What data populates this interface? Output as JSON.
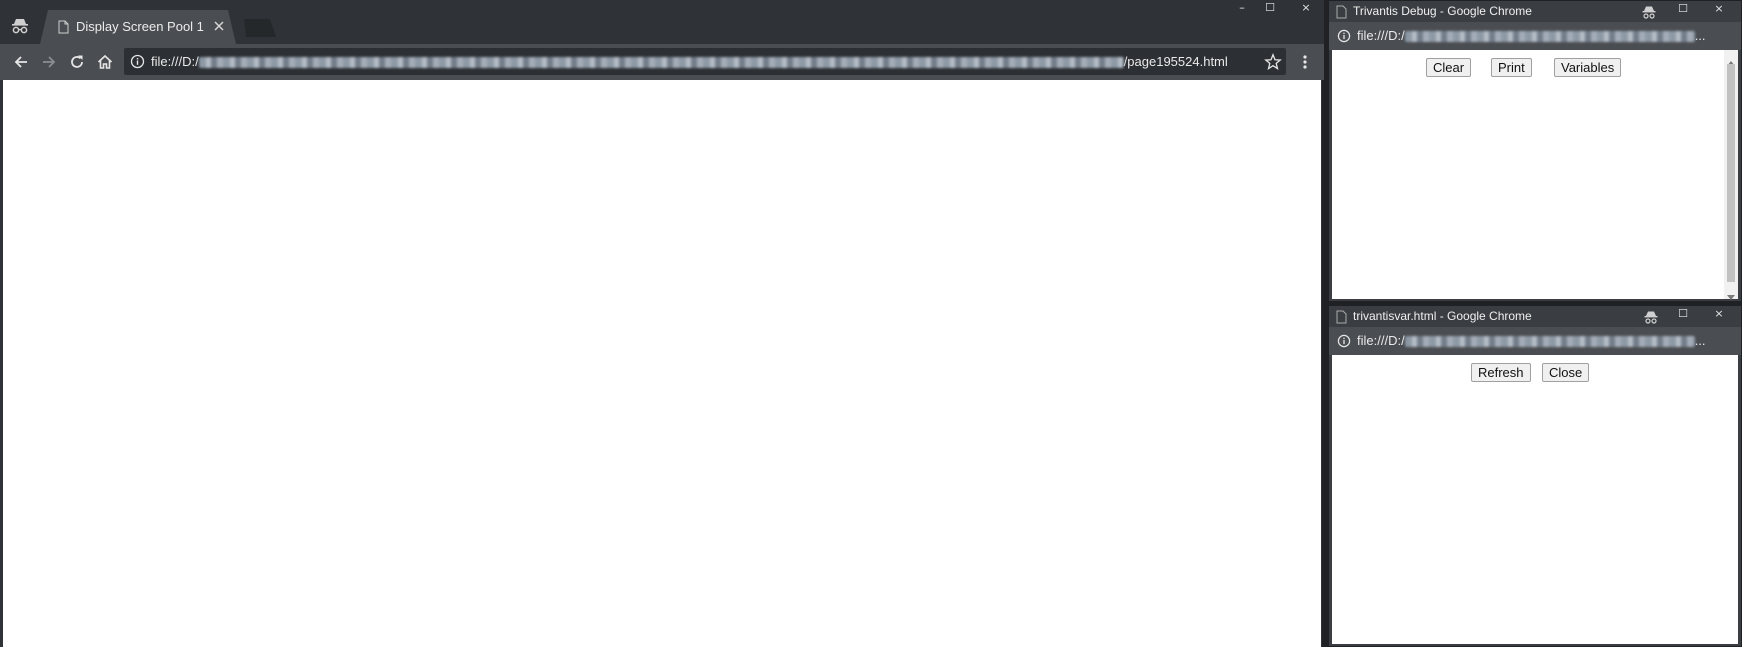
{
  "main_window": {
    "tab_title": "Display Screen Pool 1",
    "url_prefix": "file:///D:/",
    "url_suffix": "/page195524.html"
  },
  "debug_window": {
    "title": "Trivantis Debug - Google Chrome",
    "url_prefix": "file:///D:/",
    "url_suffix": "...",
    "buttons": {
      "clear": "Clear",
      "print": "Print",
      "variables": "Variables"
    }
  },
  "var_window": {
    "title": "trivantisvar.html - Google Chrome",
    "url_prefix": "file:///D:/",
    "url_suffix": "...",
    "buttons": {
      "refresh": "Refresh",
      "close": "Close"
    }
  },
  "window_controls": {
    "minimize": "–",
    "maximize": "☐",
    "close": "×"
  },
  "icons": {
    "incognito": "incognito-icon",
    "page": "page-icon",
    "back": "back-arrow-icon",
    "forward": "forward-arrow-icon",
    "reload": "reload-icon",
    "home": "home-icon",
    "info": "info-icon",
    "star": "star-icon",
    "menu": "kebab-menu-icon",
    "scroll_up": "scroll-up-icon",
    "scroll_down": "scroll-down-icon"
  },
  "colors": {
    "frame": "#3a3d41",
    "tab_strip": "#2f3236",
    "active_tab": "#4a4d51",
    "toolbar": "#4a4d51",
    "omnibox": "#2c2f33",
    "content": "#ffffff"
  }
}
